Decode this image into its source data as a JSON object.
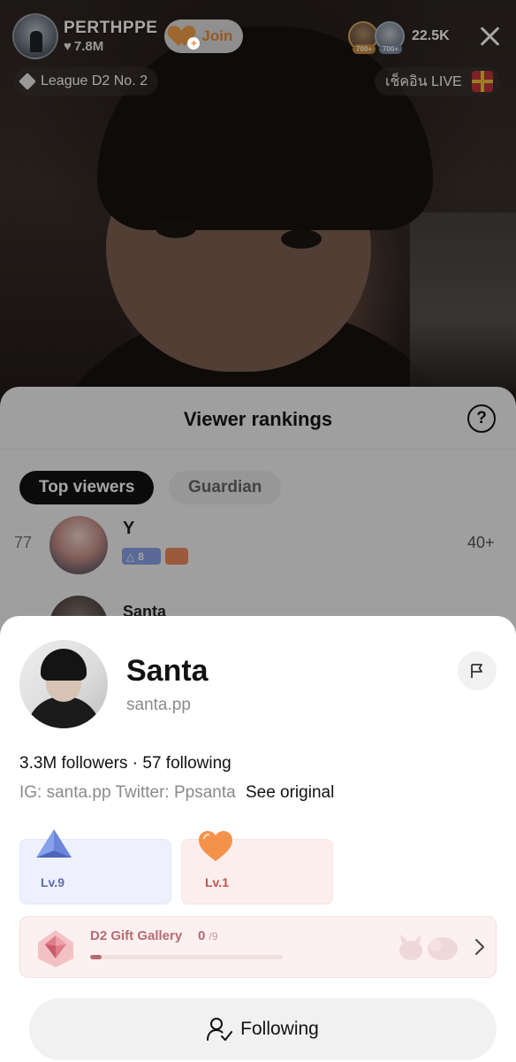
{
  "live": {
    "host_name": "PERTHPPE",
    "host_likes": "7.8M",
    "join_label": "Join",
    "viewer_badge_a": "700+",
    "viewer_badge_b": "700+",
    "viewer_count": "22.5K",
    "league_label": "League D2 No. 2",
    "checkin_label": "เช็คอิน LIVE"
  },
  "rankings": {
    "title": "Viewer rankings",
    "help_symbol": "?",
    "tabs": [
      {
        "label": "Top viewers",
        "active": true
      },
      {
        "label": "Guardian",
        "active": false
      }
    ],
    "rows": [
      {
        "rank": "77",
        "name": "Y",
        "level": "8",
        "score": "40+"
      },
      {
        "rank": "",
        "name": "Santa",
        "level": "",
        "score": ""
      }
    ]
  },
  "profile": {
    "display_name": "Santa",
    "username": "santa.pp",
    "stats": "3.3M followers · 57 following",
    "bio": "IG: santa.pp Twitter: Ppsanta",
    "see_original": "See original",
    "levels": [
      {
        "label": "Lv.9",
        "icon": "blue-triangle-icon"
      },
      {
        "label": "Lv.1",
        "icon": "orange-heart-icon"
      }
    ],
    "gallery": {
      "title": "D2 Gift Gallery",
      "collected": "0",
      "total": "/9",
      "progress": 0.06
    },
    "follow_label": "Following"
  },
  "colors": {
    "accent_orange": "#f0a04b",
    "level_blue": "#5c6fb0",
    "level_pink": "#c0564a",
    "gallery_text": "#b86b72"
  }
}
